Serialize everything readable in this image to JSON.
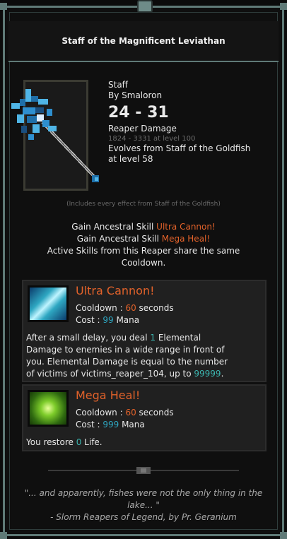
{
  "title": "Staff of the Magnificent Leviathan",
  "item": {
    "type": "Staff",
    "author": "By Smaloron",
    "damage": "24 - 31",
    "damage_type": "Reaper Damage",
    "damage_at_level": "1824 - 3331 at level 100",
    "evolves_line1": "Evolves from Staff of the Goldfish",
    "evolves_line2": "at level 58"
  },
  "includes_note": "(Includes every effect from Staff of the Goldfish)",
  "skills_text": {
    "line1_prefix": "Gain Ancestral Skill ",
    "line1_skill": "Ultra Cannon!",
    "line2_prefix": "Gain Ancestral Skill ",
    "line2_skill": "Mega Heal!",
    "line3": "Active Skills from this Reaper share the same",
    "line4": "Cooldown."
  },
  "cards": [
    {
      "name": "Ultra Cannon!",
      "cooldown_label": "Cooldown : ",
      "cooldown_value": "60",
      "cooldown_unit": " seconds",
      "cost_label": "Cost : ",
      "cost_value": "99",
      "cost_unit": " Mana",
      "desc_l1_a": "After a small delay, you deal ",
      "desc_l1_num": "1",
      "desc_l1_b": " Elemental",
      "desc_l2": "Damage to enemies in a wide range in front of",
      "desc_l3": "you. Elemental Damage is equal to the number",
      "desc_l4_a": "of victims of victims_reaper_104, up to ",
      "desc_l4_num": "99999",
      "desc_l4_b": ".",
      "icon": "ultra-cannon-icon",
      "icon_color": "#2ea7c2"
    },
    {
      "name": "Mega Heal!",
      "cooldown_label": "Cooldown : ",
      "cooldown_value": "60",
      "cooldown_unit": " seconds",
      "cost_label": "Cost : ",
      "cost_value": "999",
      "cost_unit": " Mana",
      "desc_a": "You restore ",
      "desc_num": "0",
      "desc_b": " Life.",
      "icon": "mega-heal-icon",
      "icon_color": "#7dcc2a"
    }
  ],
  "quote_line1": "\"... and apparently, fishes were not the only thing in the",
  "quote_line2": "lake... \"",
  "quote_line3": "- Slorm Reapers of Legend, by Pr. Geranium",
  "colors": {
    "accent": "#e2622a",
    "value": "#2ea7c2",
    "frame": "#5f7a77"
  }
}
